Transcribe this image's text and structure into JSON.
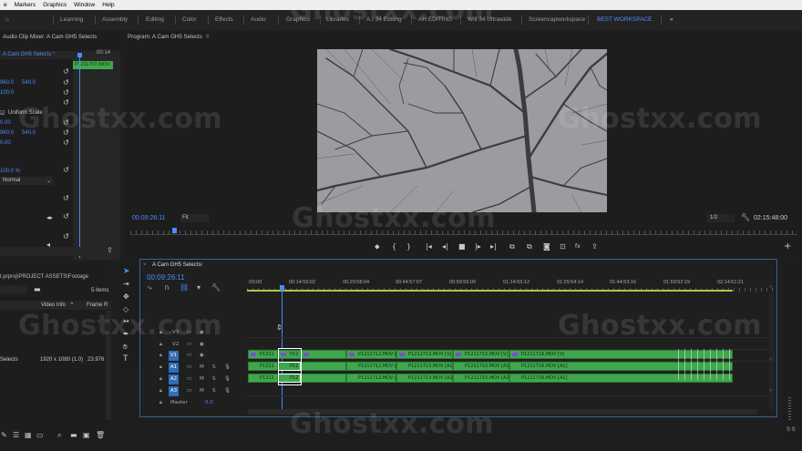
{
  "menu": {
    "items": [
      "e",
      "Markers",
      "Graphics",
      "Window",
      "Help"
    ]
  },
  "workspaces": {
    "items": [
      "Learning",
      "Assembly",
      "Editing",
      "Color",
      "Effects",
      "Audio",
      "Graphics",
      "Libraries",
      "A.I 34 Editing",
      "AH EDITING",
      "Will 34 Ultrawide",
      "Screencapworkspace",
      "BEST WORKSPACE"
    ],
    "active": "BEST WORKSPACE",
    "more": "»"
  },
  "effect_controls": {
    "tab": "Audio Clip Mixer: A Cam GH5 Selects",
    "source": "A Cam GH5 Selects *",
    "clip_label": "P1211707.MOV",
    "timecode_short": "00:14",
    "pos_x": "960.0",
    "pos_y": "540.0",
    "scale": "100.0",
    "uniform_scale": "Uniform Scale",
    "anchor_x": "960.0",
    "anchor_y": "540.0",
    "val_000": "0.00",
    "val_00": "0.00",
    "opacity": "100.0 %",
    "blend": "Normal"
  },
  "program": {
    "tab": "Program: A Cam GH5 Selects",
    "timecode": "00:09:26:11",
    "fit": "Fit",
    "resolution": "1/2",
    "duration": "02:15:48:00"
  },
  "project": {
    "path": "t.prproj\\PROJECT ASSETS\\Footage",
    "items_count": "5 items",
    "col_video_info": "Video Info",
    "col_frame_rate": "Frame R",
    "item_name": "Selects",
    "item_info": "1920 x 1080 (1.0)",
    "item_fps": "23.976 fp"
  },
  "timeline": {
    "tab": "A Cam GH5 Selects",
    "timecode": "00:09:26:11",
    "ruler": [
      ":00:00",
      "00:14:59:02",
      "00:29:58:04",
      "00:44:57:07",
      "00:59:56:09",
      "01:14:55:12",
      "01:29:54:14",
      "01:44:53:16",
      "01:59:52:19",
      "02:14:51:21"
    ],
    "tracks": {
      "v3": "V3",
      "v2": "V2",
      "v1": "V1",
      "a1": "A1",
      "a2": "A2",
      "a3": "A3",
      "master": "Master",
      "master_val": "0.0",
      "m": "M",
      "s": "S"
    },
    "clips_v1": [
      "P1211",
      "P12",
      "P1211712.MOV [V]",
      "P1211713.MOV [V]",
      "P1211715.MOV [V]",
      "P1211716.MOV [V]"
    ],
    "clips_a1": [
      "P1211",
      "P12",
      "P1211712.MOV [A1]",
      "P1211713.MOV [A1]",
      "P1211715.MOV [A1]",
      "P1211716.MOV [A1]"
    ],
    "clips_a2": [
      "P1211",
      "P12",
      "P1211712.MOV [A2]",
      "P1211713.MOV [A2]",
      "P1211715.MOV [A2]",
      "P1211716.MOV [A2]"
    ]
  },
  "audio_meter": {
    "label": "S S"
  },
  "watermark": "Ghostxx.com",
  "colors": {
    "accent": "#4b8cf7",
    "clip_green": "#3fa84c",
    "active_ws": "#4f8fff"
  }
}
